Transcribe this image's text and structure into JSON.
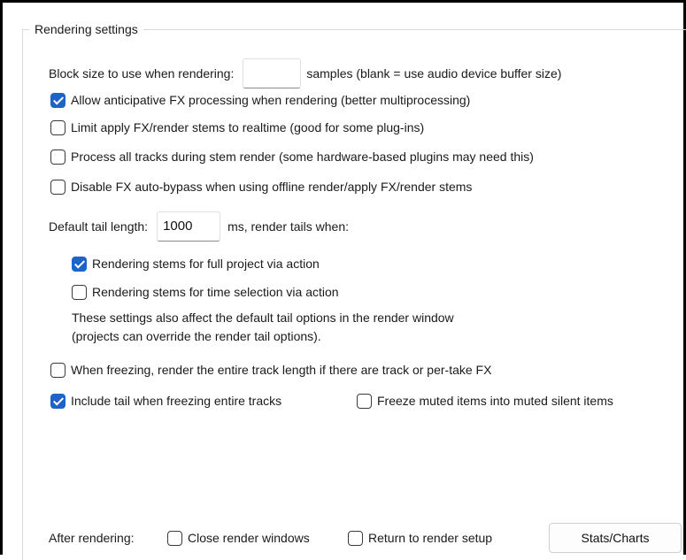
{
  "group": {
    "title": "Rendering settings"
  },
  "block_size": {
    "label": "Block size to use when rendering:",
    "value": "",
    "suffix": "samples (blank = use audio device buffer size)"
  },
  "options": {
    "anticipative_fx": {
      "label": "Allow anticipative FX processing when rendering (better multiprocessing)",
      "checked": true
    },
    "limit_realtime": {
      "label": "Limit apply FX/render stems to realtime (good for some plug-ins)",
      "checked": false
    },
    "process_all_tracks": {
      "label": "Process all tracks during stem render (some hardware-based plugins may need this)",
      "checked": false
    },
    "disable_auto_bypass": {
      "label": "Disable FX auto-bypass when using offline render/apply FX/render stems",
      "checked": false
    }
  },
  "tail": {
    "label": "Default tail length:",
    "value": "1000",
    "suffix": "ms, render tails when:",
    "full_project": {
      "label": "Rendering stems for full project via action",
      "checked": true
    },
    "time_selection": {
      "label": "Rendering stems for time selection via action",
      "checked": false
    },
    "note_line1": "These settings also affect the default tail options in the render window",
    "note_line2": "(projects can override the render tail options)."
  },
  "freeze": {
    "entire_length": {
      "label": "When freezing, render the entire track length if there are track or per-take FX",
      "checked": false
    },
    "include_tail": {
      "label": "Include tail when freezing entire tracks",
      "checked": true
    },
    "muted_items": {
      "label": "Freeze muted items into muted silent items",
      "checked": false
    }
  },
  "after": {
    "label": "After rendering:",
    "close_windows": {
      "label": "Close render windows",
      "checked": false
    },
    "return_setup": {
      "label": "Return to render setup",
      "checked": false
    },
    "stats_button": "Stats/Charts"
  }
}
